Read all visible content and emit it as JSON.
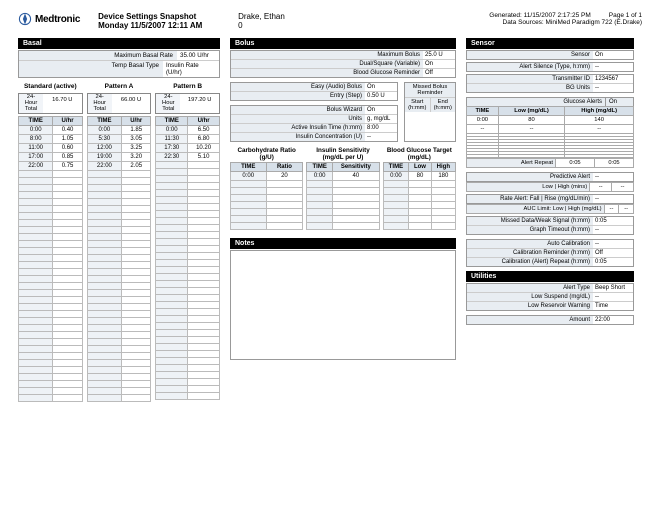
{
  "header": {
    "brand": "Medtronic",
    "title": "Device Settings Snapshot",
    "datetime": "Monday 11/5/2007 12:11 AM",
    "patient_name": "Drake, Ethan",
    "patient_id": "0",
    "generated_label": "Generated:",
    "generated": "11/15/2007 2:17:25 PM",
    "page_label": "Page 1 of 1",
    "sources_label": "Data Sources:",
    "sources": "MiniMed Paradigm 722 (E.Drake)"
  },
  "basal": {
    "section": "Basal",
    "max_label": "Maximum Basal Rate",
    "max": "35.00 U/hr",
    "temp_label": "Temp Basal Type",
    "temp": "Insulin Rate (U/hr)",
    "std_name": "Standard (active)",
    "std_total": "16.70 U",
    "a_name": "Pattern A",
    "a_total": "66.00 U",
    "b_name": "Pattern B",
    "b_total": "197.20 U",
    "total_label": "24-Hour Total",
    "time_h": "TIME",
    "rate_h": "U/hr",
    "std": [
      [
        "0:00",
        "0.40"
      ],
      [
        "8:00",
        "1.05"
      ],
      [
        "11:00",
        "0.60"
      ],
      [
        "17:00",
        "0.85"
      ],
      [
        "22:00",
        "0.75"
      ]
    ],
    "a": [
      [
        "0:00",
        "1.85"
      ],
      [
        "5:30",
        "3.05"
      ],
      [
        "12:00",
        "3.25"
      ],
      [
        "19:00",
        "3.20"
      ],
      [
        "22:00",
        "2.05"
      ]
    ],
    "b": [
      [
        "0:00",
        "6.50"
      ],
      [
        "11:30",
        "6.80"
      ],
      [
        "17:30",
        "10.20"
      ],
      [
        "22:30",
        "5.10"
      ]
    ]
  },
  "bolus": {
    "section": "Bolus",
    "max_l": "Maximum Bolus",
    "max_v": "25.0 U",
    "dual_l": "Dual/Square (Variable)",
    "dual_v": "On",
    "bgr_l": "Blood Glucose Reminder",
    "bgr_v": "Off",
    "easy_l": "Easy (Audio) Bolus",
    "easy_v": "On",
    "entry_l": "Entry (Step)",
    "entry_v": "0.50 U",
    "wiz_l": "Bolus Wizard",
    "wiz_v": "On",
    "units_l": "Units",
    "units_v": "g, mg/dL",
    "ait_l": "Active Insulin Time (h:mm)",
    "ait_v": "8:00",
    "ic_l": "Insulin Concentration (U)",
    "ic_v": "--",
    "missed_title": "Missed Bolus Reminder",
    "missed_start": "Start (h:mm)",
    "missed_end": "End (h:mm)",
    "carb_title": "Carbohydrate Ratio (g/U)",
    "carb_h1": "TIME",
    "carb_h2": "Ratio",
    "carb": [
      [
        "0:00",
        "20"
      ]
    ],
    "sens_title": "Insulin Sensitivity (mg/dL per U)",
    "sens_h1": "TIME",
    "sens_h2": "Sensitivity",
    "sens": [
      [
        "0:00",
        "40"
      ]
    ],
    "bgt_title": "Blood Glucose Target (mg/dL)",
    "bgt_h1": "TIME",
    "bgt_h2": "Low",
    "bgt_h3": "High",
    "bgt": [
      [
        "0:00",
        "80",
        "180"
      ]
    ]
  },
  "notes": {
    "section": "Notes"
  },
  "sensor": {
    "section": "Sensor",
    "on_l": "Sensor",
    "on_v": "On",
    "sil_l": "Alert Silence (Type, h:mm)",
    "sil_v": "--",
    "tx_l": "Transmitter ID",
    "tx_v": "1234567",
    "bgu_l": "BG Units",
    "bgu_v": "--",
    "ga_title": "Glucose Alerts",
    "ga_on": "On",
    "ga_h1": "TIME",
    "ga_h2": "Low (mg/dL)",
    "ga_h3": "High (mg/dL)",
    "ga_rows": [
      [
        "0:00",
        "80",
        "140"
      ],
      [
        "--",
        "--",
        "--"
      ]
    ],
    "ar_l": "Alert Repeat",
    "ar_low": "0:05",
    "ar_high": "0:05",
    "pa_l": "Predictive Alert",
    "pa_v": "--",
    "plh_l": "Low | High (mins)",
    "plh_low": "--",
    "plh_high": "--",
    "rate_l": "Rate Alert: Fall | Rise (mg/dL/min)",
    "rate_v": "--",
    "auc_l": "AUC Limit: Low | High (mg/dL)",
    "auc_low": "--",
    "auc_high": "--",
    "mws_l": "Missed Data/Weak Signal (h:mm)",
    "mws_v": "0:05",
    "gt_l": "Graph Timeout (h:mm)",
    "gt_v": "--",
    "ac_l": "Auto Calibration",
    "ac_v": "--",
    "cr_l": "Calibration Reminder (h:mm)",
    "cr_v": "Off",
    "car_l": "Calibration (Alert) Repeat (h:mm)",
    "car_v": "0:05"
  },
  "utilities": {
    "section": "Utilities",
    "at_l": "Alert Type",
    "at_v": "Beep Short",
    "ls_l": "Low Suspend (mg/dL)",
    "ls_v": "--",
    "lrw_l": "Low Reservoir Warning",
    "lrw_v": "Time",
    "amt_l": "Amount",
    "amt_v": "22:00"
  }
}
